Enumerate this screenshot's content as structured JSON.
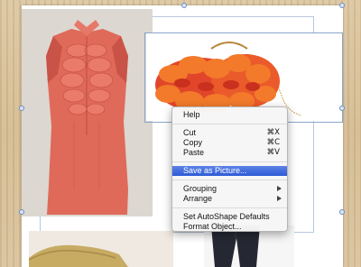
{
  "menu": {
    "help": "Help",
    "cut": {
      "label": "Cut",
      "shortcut": "⌘X"
    },
    "copy": {
      "label": "Copy",
      "shortcut": "⌘C"
    },
    "paste": {
      "label": "Paste",
      "shortcut": "⌘V"
    },
    "save_as_picture": "Save as Picture...",
    "grouping": "Grouping",
    "arrange": "Arrange",
    "set_autoshape_defaults": "Set AutoShape Defaults",
    "format_object": "Format Object..."
  },
  "icons": {
    "submenu": "chevron-right-icon",
    "selection_handle": "selection-handle-icon"
  },
  "colors": {
    "menu_highlight": "#2d5ad6",
    "blouse": "#e06b5c",
    "clutch": "#e2462a",
    "selection": "#6f8fbf"
  }
}
